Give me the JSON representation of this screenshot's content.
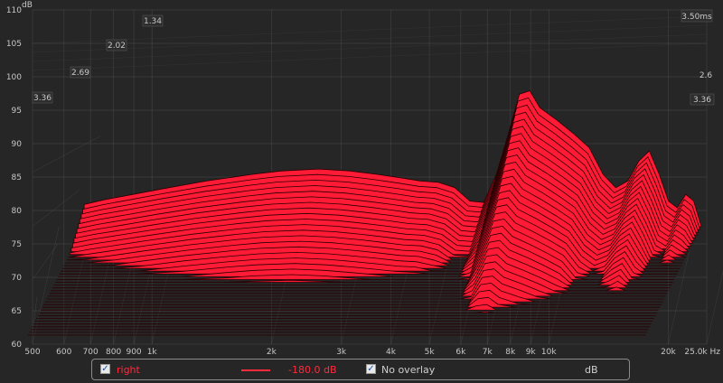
{
  "colors": {
    "background": "#262626",
    "grid": "#5a5a5a",
    "fill": "#ff1a35",
    "stroke": "#2a0003",
    "legend_red": "#ff2a3c"
  },
  "chart_data": {
    "type": "area",
    "title": "",
    "subtitle": "",
    "x_scale": "log",
    "xlim": [
      500,
      25000
    ],
    "ylim": [
      60,
      110
    ],
    "x_ticks": [
      {
        "v": 500,
        "label": "500"
      },
      {
        "v": 600,
        "label": "600"
      },
      {
        "v": 700,
        "label": "700"
      },
      {
        "v": 800,
        "label": "800"
      },
      {
        "v": 900,
        "label": "900"
      },
      {
        "v": 1000,
        "label": "1k"
      },
      {
        "v": 2000,
        "label": "2k"
      },
      {
        "v": 3000,
        "label": "3k"
      },
      {
        "v": 4000,
        "label": "4k"
      },
      {
        "v": 5000,
        "label": "5k"
      },
      {
        "v": 6000,
        "label": "6k"
      },
      {
        "v": 7000,
        "label": "7k"
      },
      {
        "v": 8000,
        "label": "8k"
      },
      {
        "v": 9000,
        "label": "9k"
      },
      {
        "v": 10000,
        "label": "10k"
      },
      {
        "v": 20000,
        "label": "20k"
      },
      {
        "v": 25000,
        "label": "25.0k Hz"
      }
    ],
    "y_ticks": [
      {
        "v": 60,
        "label": "60"
      },
      {
        "v": 65,
        "label": "65"
      },
      {
        "v": 70,
        "label": "70"
      },
      {
        "v": 75,
        "label": "75"
      },
      {
        "v": 80,
        "label": "80"
      },
      {
        "v": 85,
        "label": "85"
      },
      {
        "v": 90,
        "label": "90"
      },
      {
        "v": 95,
        "label": "95"
      },
      {
        "v": 100,
        "label": "100"
      },
      {
        "v": 105,
        "label": "105"
      },
      {
        "v": 110,
        "label": "110"
      }
    ],
    "ylabel": "dB",
    "time_ticks": [
      {
        "t": 3.36,
        "label": "3.36"
      },
      {
        "t": 2.69,
        "label": "2.69"
      },
      {
        "t": 2.02,
        "label": "2.02"
      },
      {
        "t": 1.34,
        "label": "1.34"
      }
    ],
    "time_max_label": "3.50ms",
    "time_right_labels": [
      "3.36",
      "2.6"
    ],
    "slices": 40,
    "ridge_profile": [
      {
        "f": 640,
        "db": 75.5
      },
      {
        "f": 720,
        "db": 76.2
      },
      {
        "f": 850,
        "db": 77.0
      },
      {
        "f": 1000,
        "db": 77.8
      },
      {
        "f": 1300,
        "db": 79.0
      },
      {
        "f": 1700,
        "db": 80.0
      },
      {
        "f": 2000,
        "db": 80.5
      },
      {
        "f": 2500,
        "db": 80.8
      },
      {
        "f": 3000,
        "db": 80.5
      },
      {
        "f": 3500,
        "db": 80.0
      },
      {
        "f": 4000,
        "db": 79.5
      },
      {
        "f": 4500,
        "db": 79.0
      },
      {
        "f": 5000,
        "db": 78.8
      },
      {
        "f": 5500,
        "db": 78.0
      },
      {
        "f": 6000,
        "db": 76.0
      },
      {
        "f": 6500,
        "db": 75.8
      },
      {
        "f": 7000,
        "db": 80.0
      },
      {
        "f": 7500,
        "db": 86.0
      },
      {
        "f": 8000,
        "db": 92.0
      },
      {
        "f": 8500,
        "db": 92.5
      },
      {
        "f": 9000,
        "db": 90.0
      },
      {
        "f": 10000,
        "db": 88.0
      },
      {
        "f": 11000,
        "db": 86.0
      },
      {
        "f": 12000,
        "db": 84.0
      },
      {
        "f": 13000,
        "db": 80.0
      },
      {
        "f": 14000,
        "db": 78.0
      },
      {
        "f": 15000,
        "db": 79.0
      },
      {
        "f": 16000,
        "db": 82.0
      },
      {
        "f": 17000,
        "db": 83.5
      },
      {
        "f": 18000,
        "db": 80.0
      },
      {
        "f": 19000,
        "db": 76.0
      },
      {
        "f": 20000,
        "db": 75.0
      },
      {
        "f": 21000,
        "db": 77.0
      },
      {
        "f": 22000,
        "db": 76.0
      },
      {
        "f": 23000,
        "db": 72.0
      }
    ],
    "legend": [
      {
        "name": "right",
        "checked": true,
        "value": "-180.0 dB"
      },
      {
        "name": "No overlay",
        "checked": true,
        "value": "dB"
      }
    ]
  },
  "legend": {
    "series_label": "right",
    "series_value": "-180.0 dB",
    "overlay_label": "No overlay",
    "unit_label": "dB",
    "check_glyph": "✓"
  }
}
